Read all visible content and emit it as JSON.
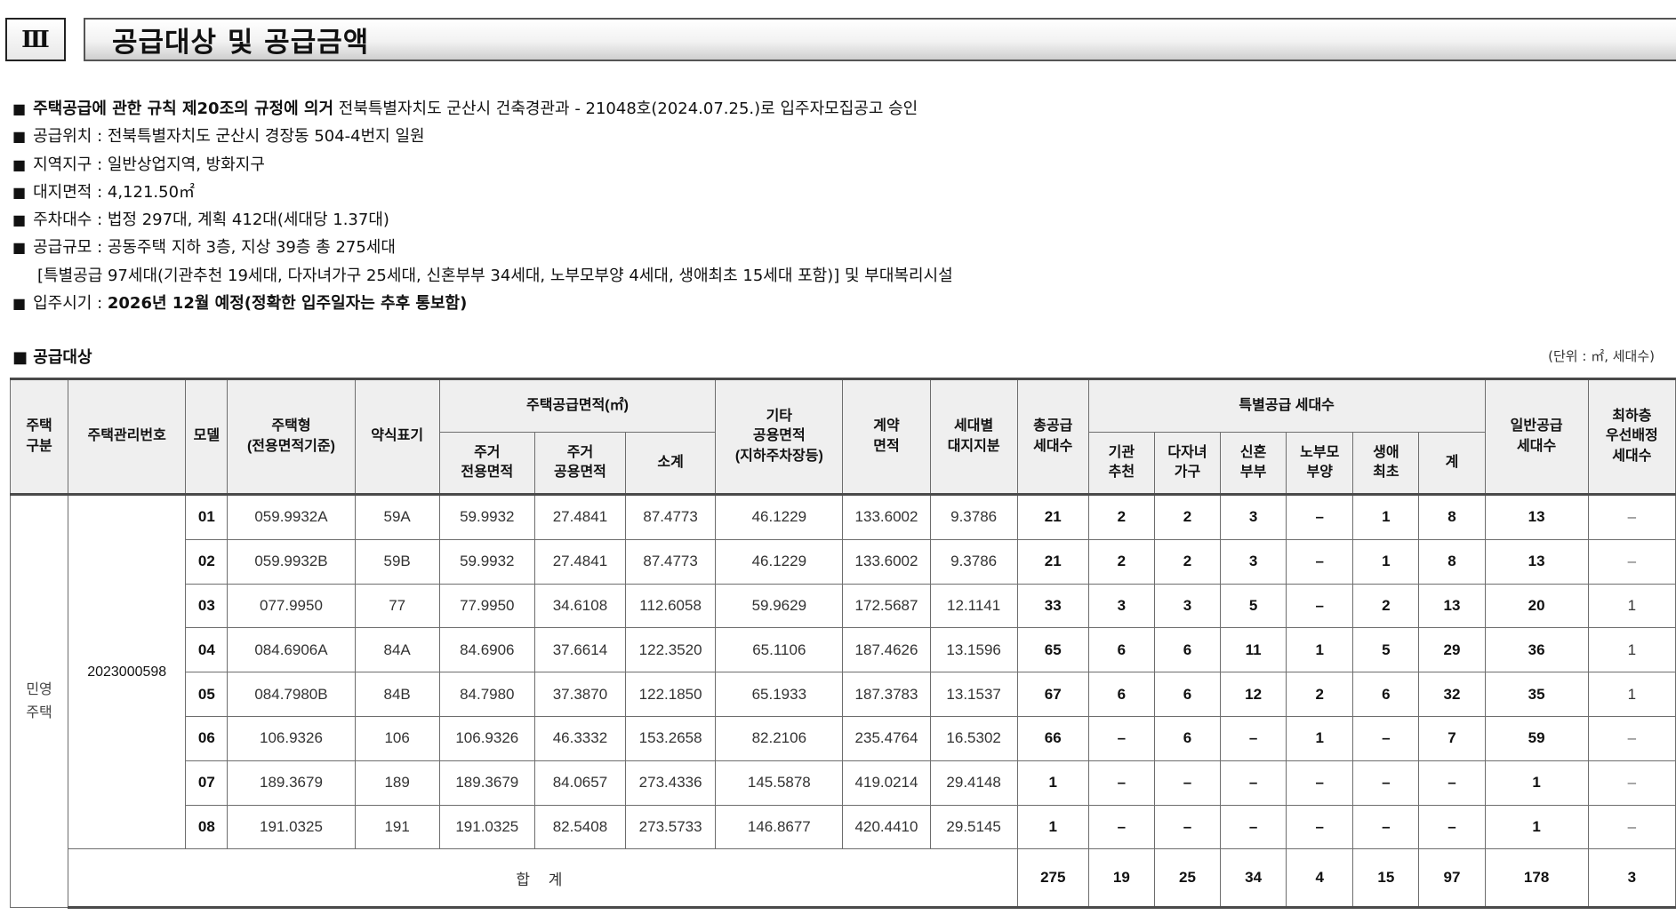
{
  "section": {
    "number": "Ⅲ",
    "title": "공급대상 및 공급금액"
  },
  "info": {
    "approval_bold": "주택공급에 관한 규칙 제20조의 규정에 의거",
    "approval_rest": " 전북특별자치도 군산시 건축경관과 - 21048호(2024.07.25.)로 입주자모집공고 승인",
    "location": "공급위치 : 전북특별자치도 군산시 경장동 504-4번지 일원",
    "zone": "지역지구 : 일반상업지역, 방화지구",
    "site_area": "대지면적 : 4,121.50㎡",
    "parking": "주차대수 : 법정 297대, 계획 412대(세대당 1.37대)",
    "scale": "공급규모 : 공동주택 지하 3층, 지상 39층 총 275세대",
    "scale_detail": "[특별공급 97세대(기관추천 19세대, 다자녀가구 25세대, 신혼부부 34세대, 노부모부양 4세대, 생애최초 15세대 포함)] 및 부대복리시설",
    "move_in_label": "입주시기 : ",
    "move_in_bold": "2026년 12월 예정(정확한 입주일자는 추후 통보함)",
    "bullet": "■"
  },
  "supply": {
    "heading": "■ 공급대상",
    "unit_note": "(단위 : ㎡, 세대수)"
  },
  "table": {
    "headers": {
      "category": "주택\n구분",
      "code": "주택관리번호",
      "model": "모델",
      "type": "주택형\n(전용면적기준)",
      "short": "약식표기",
      "area_group": "주택공급면적(㎡)",
      "exclusive": "주거\n전용면적",
      "common": "주거\n공용면적",
      "subtotal": "소계",
      "other": "기타\n공용면적\n(지하주차장등)",
      "contract": "계약\n면적",
      "land": "세대별\n대지지분",
      "total_supply": "총공급\n세대수",
      "special_group": "특별공급 세대수",
      "inst": "기관\n추천",
      "multi": "다자녀\n가구",
      "newly": "신혼\n부부",
      "elderly": "노부모\n부양",
      "first": "생애\n최초",
      "sum": "계",
      "general": "일반공급\n세대수",
      "lowest": "최하층\n우선배정\n세대수"
    },
    "category_value": "민영\n주택",
    "code_value": "2023000598",
    "rows": [
      {
        "model": "01",
        "type": "059.9932A",
        "short": "59A",
        "exclusive": "59.9932",
        "common": "27.4841",
        "subtotal": "87.4773",
        "other": "46.1229",
        "contract": "133.6002",
        "land": "9.3786",
        "total": "21",
        "inst": "2",
        "multi": "2",
        "newly": "3",
        "elderly": "–",
        "first": "1",
        "sum": "8",
        "general": "13",
        "lowest": "–"
      },
      {
        "model": "02",
        "type": "059.9932B",
        "short": "59B",
        "exclusive": "59.9932",
        "common": "27.4841",
        "subtotal": "87.4773",
        "other": "46.1229",
        "contract": "133.6002",
        "land": "9.3786",
        "total": "21",
        "inst": "2",
        "multi": "2",
        "newly": "3",
        "elderly": "–",
        "first": "1",
        "sum": "8",
        "general": "13",
        "lowest": "–"
      },
      {
        "model": "03",
        "type": "077.9950",
        "short": "77",
        "exclusive": "77.9950",
        "common": "34.6108",
        "subtotal": "112.6058",
        "other": "59.9629",
        "contract": "172.5687",
        "land": "12.1141",
        "total": "33",
        "inst": "3",
        "multi": "3",
        "newly": "5",
        "elderly": "–",
        "first": "2",
        "sum": "13",
        "general": "20",
        "lowest": "1"
      },
      {
        "model": "04",
        "type": "084.6906A",
        "short": "84A",
        "exclusive": "84.6906",
        "common": "37.6614",
        "subtotal": "122.3520",
        "other": "65.1106",
        "contract": "187.4626",
        "land": "13.1596",
        "total": "65",
        "inst": "6",
        "multi": "6",
        "newly": "11",
        "elderly": "1",
        "first": "5",
        "sum": "29",
        "general": "36",
        "lowest": "1"
      },
      {
        "model": "05",
        "type": "084.7980B",
        "short": "84B",
        "exclusive": "84.7980",
        "common": "37.3870",
        "subtotal": "122.1850",
        "other": "65.1933",
        "contract": "187.3783",
        "land": "13.1537",
        "total": "67",
        "inst": "6",
        "multi": "6",
        "newly": "12",
        "elderly": "2",
        "first": "6",
        "sum": "32",
        "general": "35",
        "lowest": "1"
      },
      {
        "model": "06",
        "type": "106.9326",
        "short": "106",
        "exclusive": "106.9326",
        "common": "46.3332",
        "subtotal": "153.2658",
        "other": "82.2106",
        "contract": "235.4764",
        "land": "16.5302",
        "total": "66",
        "inst": "–",
        "multi": "6",
        "newly": "–",
        "elderly": "1",
        "first": "–",
        "sum": "7",
        "general": "59",
        "lowest": "–"
      },
      {
        "model": "07",
        "type": "189.3679",
        "short": "189",
        "exclusive": "189.3679",
        "common": "84.0657",
        "subtotal": "273.4336",
        "other": "145.5878",
        "contract": "419.0214",
        "land": "29.4148",
        "total": "1",
        "inst": "–",
        "multi": "–",
        "newly": "–",
        "elderly": "–",
        "first": "–",
        "sum": "–",
        "general": "1",
        "lowest": "–"
      },
      {
        "model": "08",
        "type": "191.0325",
        "short": "191",
        "exclusive": "191.0325",
        "common": "82.5408",
        "subtotal": "273.5733",
        "other": "146.8677",
        "contract": "420.4410",
        "land": "29.5145",
        "total": "1",
        "inst": "–",
        "multi": "–",
        "newly": "–",
        "elderly": "–",
        "first": "–",
        "sum": "–",
        "general": "1",
        "lowest": "–"
      }
    ],
    "total": {
      "label": "합 계",
      "total": "275",
      "inst": "19",
      "multi": "25",
      "newly": "34",
      "elderly": "4",
      "first": "15",
      "sum": "97",
      "general": "178",
      "lowest": "3"
    }
  }
}
